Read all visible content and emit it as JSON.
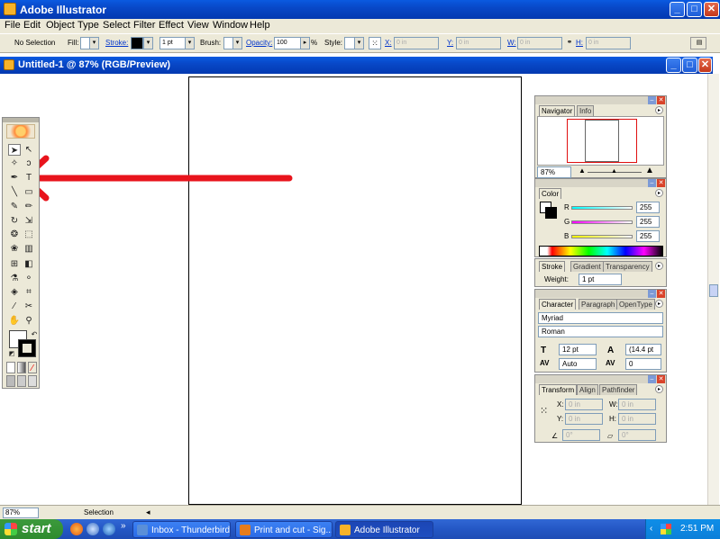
{
  "app": {
    "title": "Adobe Illustrator"
  },
  "window_buttons": {
    "minimize": "_",
    "maximize": "□",
    "close": "✕"
  },
  "menu": {
    "items": [
      "File",
      "Edit",
      "Object",
      "Type",
      "Select",
      "Filter",
      "Effect",
      "View",
      "Window",
      "Help"
    ]
  },
  "controlbar": {
    "selection": "No Selection",
    "fill_label": "Fill:",
    "stroke_label": "Stroke:",
    "stroke_weight": "1 pt",
    "brush_label": "Brush:",
    "opacity_label": "Opacity:",
    "opacity_value": "100",
    "opacity_unit": "%",
    "style_label": "Style:",
    "x_label": "X:",
    "x_value": "0 in",
    "y_label": "Y:",
    "y_value": "0 in",
    "w_label": "W:",
    "w_value": "0 in",
    "h_label": "H:",
    "h_value": "0 in"
  },
  "document": {
    "title": "Untitled-1 @ 87% (RGB/Preview)"
  },
  "statusbar": {
    "zoom": "87%",
    "tool": "Selection"
  },
  "navigator": {
    "tabs": [
      "Navigator",
      "Info"
    ],
    "zoom": "87%"
  },
  "color": {
    "tab": "Color",
    "r_label": "R",
    "r": "255",
    "g_label": "G",
    "g": "255",
    "b_label": "B",
    "b": "255"
  },
  "stroke": {
    "tabs": [
      "Stroke",
      "Gradient",
      "Transparency"
    ],
    "weight_label": "Weight:",
    "weight": "1 pt"
  },
  "character": {
    "tabs": [
      "Character",
      "Paragraph",
      "OpenType"
    ],
    "font": "Myriad",
    "style": "Roman",
    "size": "12 pt",
    "leading": "(14.4 pt",
    "kerning": "Auto",
    "tracking": "0"
  },
  "transform": {
    "tabs": [
      "Transform",
      "Align",
      "Pathfinder"
    ],
    "x_label": "X:",
    "x": "0 in",
    "y_label": "Y:",
    "y": "0 in",
    "w_label": "W:",
    "w": "0 in",
    "h_label": "H:",
    "h": "0 in",
    "rotate": "0°",
    "shear": "0°"
  },
  "taskbar": {
    "start": "start",
    "tasks": [
      "Inbox - Thunderbird",
      "Print and cut - Sig...",
      "Adobe Illustrator"
    ],
    "clock": "2:51 PM"
  },
  "colors": {
    "annotation_arrow": "#e8141c",
    "titlebar": "#0848c8"
  }
}
